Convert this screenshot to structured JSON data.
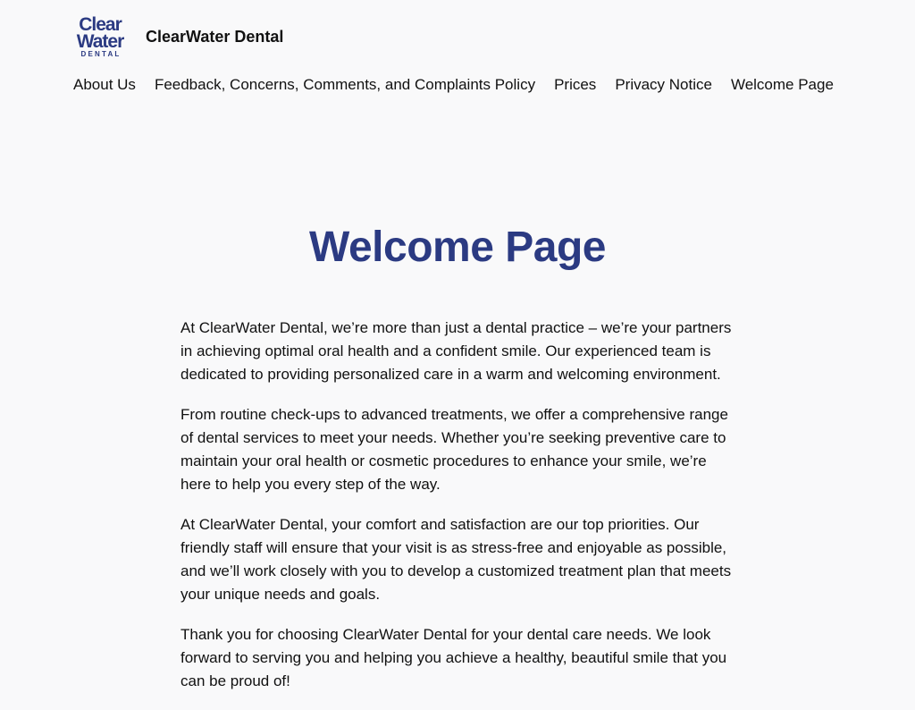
{
  "colors": {
    "brand": "#2b3a82",
    "text": "#111111",
    "background": "#f9f9fa"
  },
  "header": {
    "logo": {
      "line1": "Clear",
      "line2": "Water",
      "line3": "DENTAL"
    },
    "site_title": "ClearWater Dental"
  },
  "nav": {
    "items": [
      {
        "label": "About Us"
      },
      {
        "label": "Feedback, Concerns, Comments, and Complaints Policy"
      },
      {
        "label": "Prices"
      },
      {
        "label": "Privacy Notice"
      },
      {
        "label": "Welcome Page"
      }
    ]
  },
  "main": {
    "title": "Welcome Page",
    "paragraphs": [
      "At ClearWater Dental, we’re more than just a dental practice – we’re your partners in achieving optimal oral health and a confident smile. Our experienced team is dedicated to providing personalized care in a warm and welcoming environment.",
      "From routine check-ups to advanced treatments, we offer a comprehensive range of dental services to meet your needs. Whether you’re seeking preventive care to maintain your oral health or cosmetic procedures to enhance your smile, we’re here to help you every step of the way.",
      "At ClearWater Dental, your comfort and satisfaction are our top priorities. Our friendly staff will ensure that your visit is as stress-free and enjoyable as possible, and we’ll work closely with you to develop a customized treatment plan that meets your unique needs and goals.",
      "Thank you for choosing ClearWater Dental for your dental care needs. We look forward to serving you and helping you achieve a healthy, beautiful smile that you can be proud of!"
    ]
  }
}
